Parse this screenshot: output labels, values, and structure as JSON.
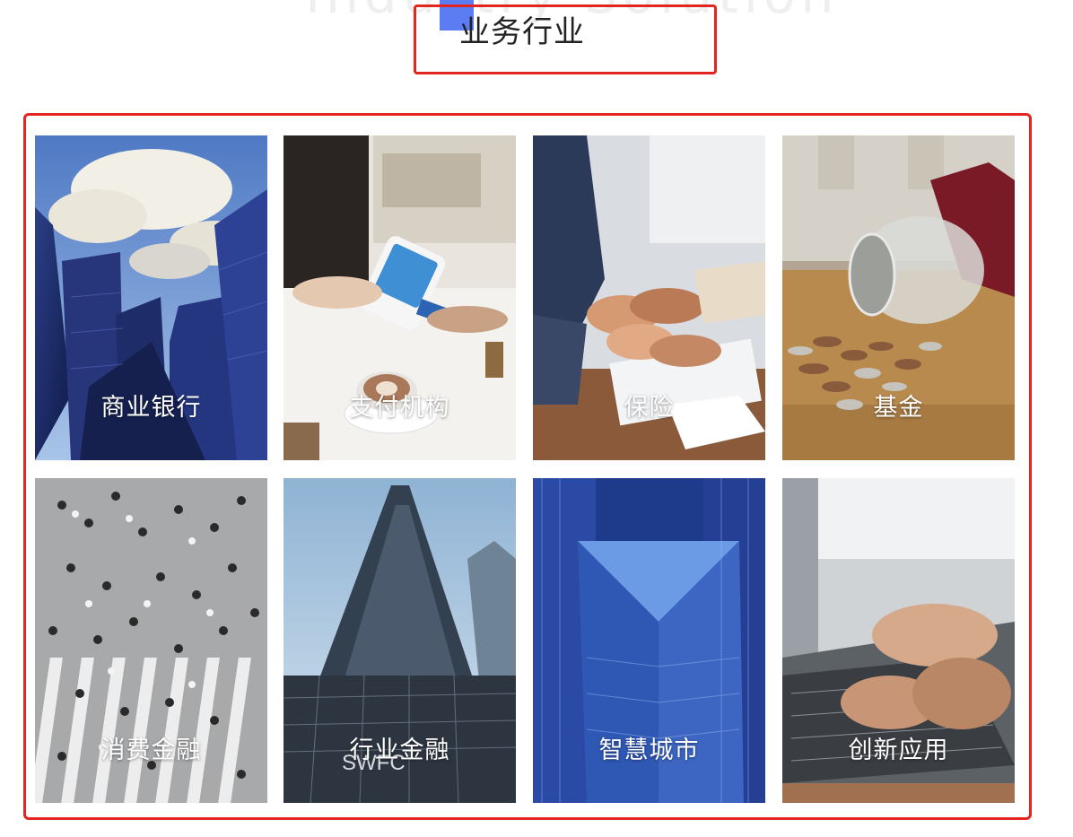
{
  "header": {
    "watermark": "Industry Solution",
    "title": "业务行业",
    "accent_color": "#5b7cf2",
    "frame_color": "#e2251f"
  },
  "industries": [
    {
      "label": "商业银行",
      "photo": "glass-skyscrapers-sky"
    },
    {
      "label": "支付机构",
      "photo": "card-payment-terminal-coffee"
    },
    {
      "label": "保险",
      "photo": "stacked-hands-teamwork"
    },
    {
      "label": "基金",
      "photo": "coin-jar-spilled"
    },
    {
      "label": "消费金融",
      "photo": "crowd-crosswalk-aerial"
    },
    {
      "label": "行业金融",
      "photo": "tower-skyscraper-upward"
    },
    {
      "label": "智慧城市",
      "photo": "blue-glass-city-towers"
    },
    {
      "label": "创新应用",
      "photo": "hands-typing-laptop"
    }
  ]
}
